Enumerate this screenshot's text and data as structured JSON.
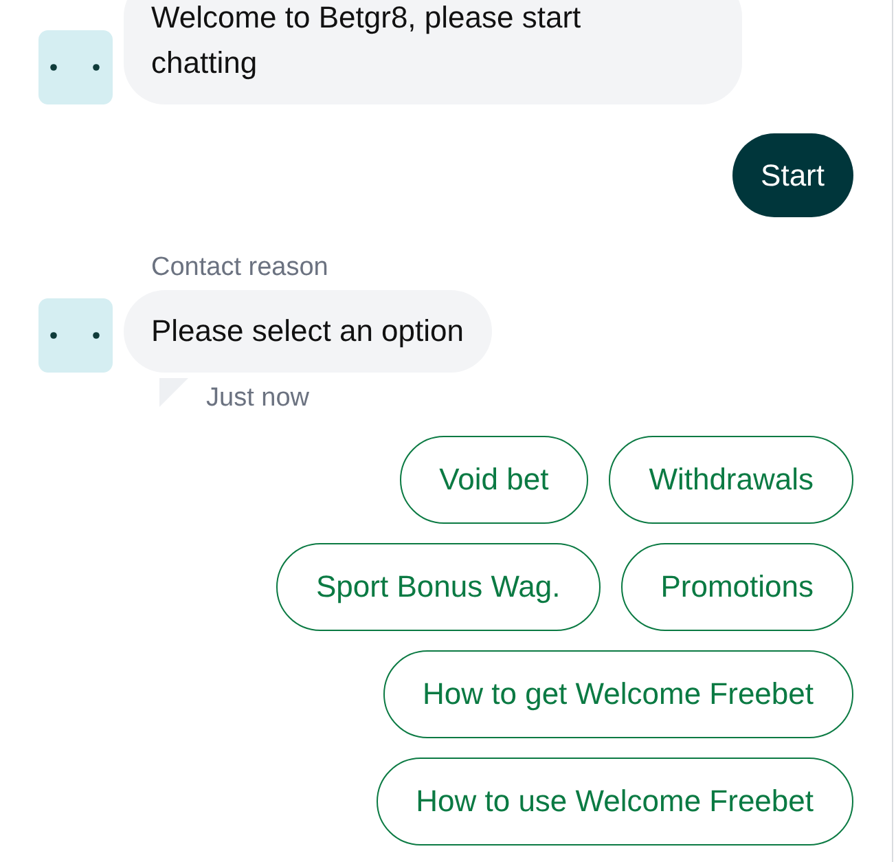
{
  "messages": [
    {
      "kind": "bot",
      "text": "Welcome to Betgr8, please start chatting"
    },
    {
      "kind": "user",
      "text": "Start"
    },
    {
      "kind": "bot",
      "label": "Contact reason",
      "text": "Please select an option",
      "time": "Just now"
    }
  ],
  "quick_replies": [
    "Void bet",
    "Withdrawals",
    "Sport Bonus Wag.",
    "Promotions",
    "How to get Welcome Freebet",
    "How to use Welcome Freebet"
  ]
}
